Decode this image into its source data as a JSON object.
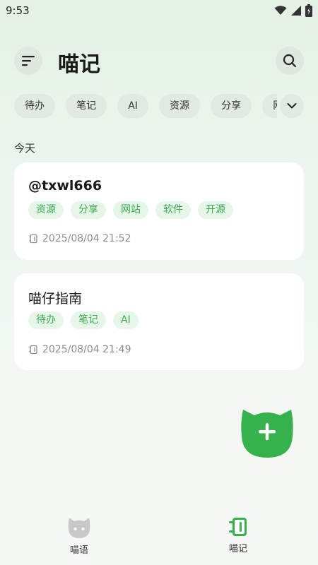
{
  "status_bar": {
    "time": "9:53"
  },
  "header": {
    "title": "喵记"
  },
  "filter_chips": [
    "待办",
    "笔记",
    "AI",
    "资源",
    "分享",
    "网站"
  ],
  "section": {
    "label": "今天"
  },
  "notes": [
    {
      "title": "@txwl666",
      "tags": [
        "资源",
        "分享",
        "网站",
        "软件",
        "开源"
      ],
      "timestamp": "2025/08/04 21:52"
    },
    {
      "title": "喵仔指南",
      "tags": [
        "待办",
        "笔记",
        "AI"
      ],
      "timestamp": "2025/08/04 21:49"
    }
  ],
  "nav": {
    "left_label": "喵语",
    "right_label": "喵记"
  },
  "colors": {
    "accent": "#3aab50",
    "fab": "#36b14c",
    "tag_bg": "#e6f6e8"
  }
}
